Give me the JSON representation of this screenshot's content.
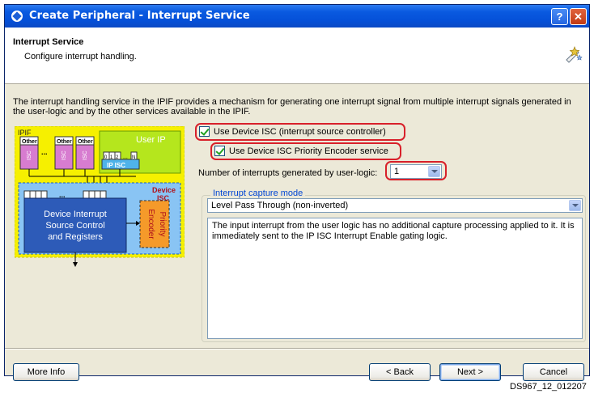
{
  "window": {
    "title": "Create Peripheral - Interrupt Service",
    "help_glyph": "?",
    "close_glyph": "✕"
  },
  "header": {
    "title": "Interrupt Service",
    "subtitle": "Configure interrupt handling."
  },
  "description": "The interrupt handling service in the IPIF provides a mechanism for generating one interrupt signal from multiple interrupt signals generated in the user-logic and by the other services available in the IPIF.",
  "diagram": {
    "ipif": "IPIF",
    "user_ip": "User IP",
    "other": "Other",
    "isc": "ISC",
    "ip_isc": "IP ISC",
    "device_isc_line1": "Device",
    "device_isc_line2": "ISC",
    "main_line1": "Device Interrupt",
    "main_line2": "Source Control",
    "main_line3": "and Registers",
    "priority": "Priority",
    "encoder": "Encoder",
    "ellipsis": "...",
    "bits_ip": [
      "0",
      "1",
      "2",
      "N"
    ],
    "bits_dev": [
      "0",
      "1",
      "2",
      "N",
      "0",
      "1",
      "2",
      "N"
    ]
  },
  "options": {
    "use_device_isc": {
      "label": "Use Device ISC (interrupt source controller)",
      "checked": true
    },
    "use_priority_encoder": {
      "label": "Use Device ISC Priority Encoder service",
      "checked": true
    },
    "num_interrupts": {
      "label": "Number of interrupts generated by user-logic:",
      "value": "1"
    }
  },
  "capture": {
    "legend": "Interrupt capture mode",
    "selected": "Level Pass Through (non-inverted)",
    "details": "The input interrupt from the user logic has no additional capture processing applied to it. It is immediately sent to the IP ISC Interrupt Enable gating logic."
  },
  "buttons": {
    "more_info": "More Info",
    "back": "< Back",
    "next": "Next >",
    "cancel": "Cancel"
  },
  "caption": "DS967_12_012207",
  "colors": {
    "title_bar": "#0550d8",
    "highlight_red": "#d8202a",
    "ipif_yellow": "#f6f000",
    "user_ip_green": "#b5e61d",
    "isc_pink": "#d77cd0",
    "device_isc_blue": "#89c4f4",
    "encoder_orange": "#f59a2a"
  }
}
